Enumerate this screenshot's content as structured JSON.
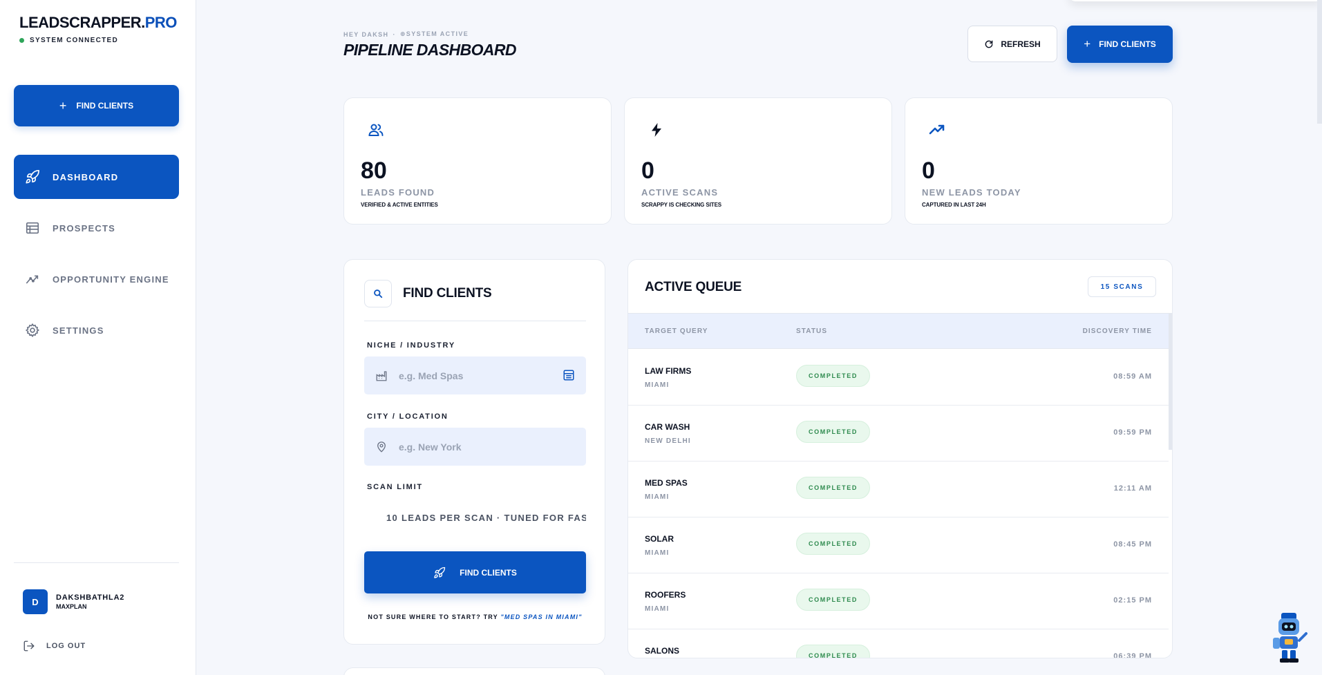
{
  "app": {
    "brand_main": "LEADSCRAPPER.",
    "brand_accent": "PRO",
    "status": "SYSTEM CONNECTED"
  },
  "colors": {
    "primary": "#0b55c0",
    "status_green": "#2fa55a",
    "completed_bg": "#e9f8ed"
  },
  "sidebar": {
    "cta_label": "FIND CLIENTS",
    "items": [
      {
        "label": "DASHBOARD",
        "icon": "rocket-icon",
        "active": true
      },
      {
        "label": "PROSPECTS",
        "icon": "table-icon",
        "active": false
      },
      {
        "label": "OPPORTUNITY ENGINE",
        "icon": "trend-icon",
        "active": false
      },
      {
        "label": "SETTINGS",
        "icon": "gear-icon",
        "active": false
      }
    ],
    "user": {
      "initial": "D",
      "name": "DAKSHBATHLA2",
      "plan": "MAXPLAN"
    },
    "logout_label": "LOG OUT"
  },
  "header": {
    "greeting": "HEY DAKSH",
    "separator": "·",
    "system_state": "⊕SYSTEM ACTIVE",
    "title": "PIPELINE DASHBOARD",
    "refresh_label": "REFRESH",
    "find_label": "FIND CLIENTS"
  },
  "stats": [
    {
      "icon": "users-icon",
      "value": "80",
      "label": "LEADS FOUND",
      "sub": "VERIFIED & ACTIVE ENTITIES"
    },
    {
      "icon": "bolt-icon",
      "value": "0",
      "label": "ACTIVE SCANS",
      "sub": "SCRAPPY IS CHECKING SITES"
    },
    {
      "icon": "trending-up-icon",
      "value": "0",
      "label": "NEW LEADS TODAY",
      "sub": "CAPTURED IN LAST 24H"
    }
  ],
  "find_form": {
    "title": "FIND CLIENTS",
    "niche_label": "NICHE / INDUSTRY",
    "niche_placeholder": "e.g. Med Spas",
    "city_label": "CITY / LOCATION",
    "city_placeholder": "e.g. New York",
    "limit_label": "SCAN LIMIT",
    "limit_value": "10 LEADS PER SCAN · TUNED FOR FAS",
    "submit_label": "FIND CLIENTS",
    "hint_prefix": "NOT SURE WHERE TO START? TRY ",
    "hint_example": "\"MED SPAS IN MIAMI\""
  },
  "queue": {
    "title": "ACTIVE QUEUE",
    "badge": "15 SCANS",
    "columns": [
      "TARGET QUERY",
      "STATUS",
      "DISCOVERY TIME"
    ],
    "rows": [
      {
        "query": "LAW FIRMS",
        "city": "MIAMI",
        "status": "COMPLETED",
        "time": "08:59 AM"
      },
      {
        "query": "CAR WASH",
        "city": "NEW DELHI",
        "status": "COMPLETED",
        "time": "09:59 PM"
      },
      {
        "query": "MED SPAS",
        "city": "MIAMI",
        "status": "COMPLETED",
        "time": "12:11 AM"
      },
      {
        "query": "SOLAR",
        "city": "MIAMI",
        "status": "COMPLETED",
        "time": "08:45 PM"
      },
      {
        "query": "ROOFERS",
        "city": "MIAMI",
        "status": "COMPLETED",
        "time": "02:15 PM"
      },
      {
        "query": "SALONS",
        "city": "",
        "status": "COMPLETED",
        "time": "06:39 PM"
      }
    ]
  }
}
